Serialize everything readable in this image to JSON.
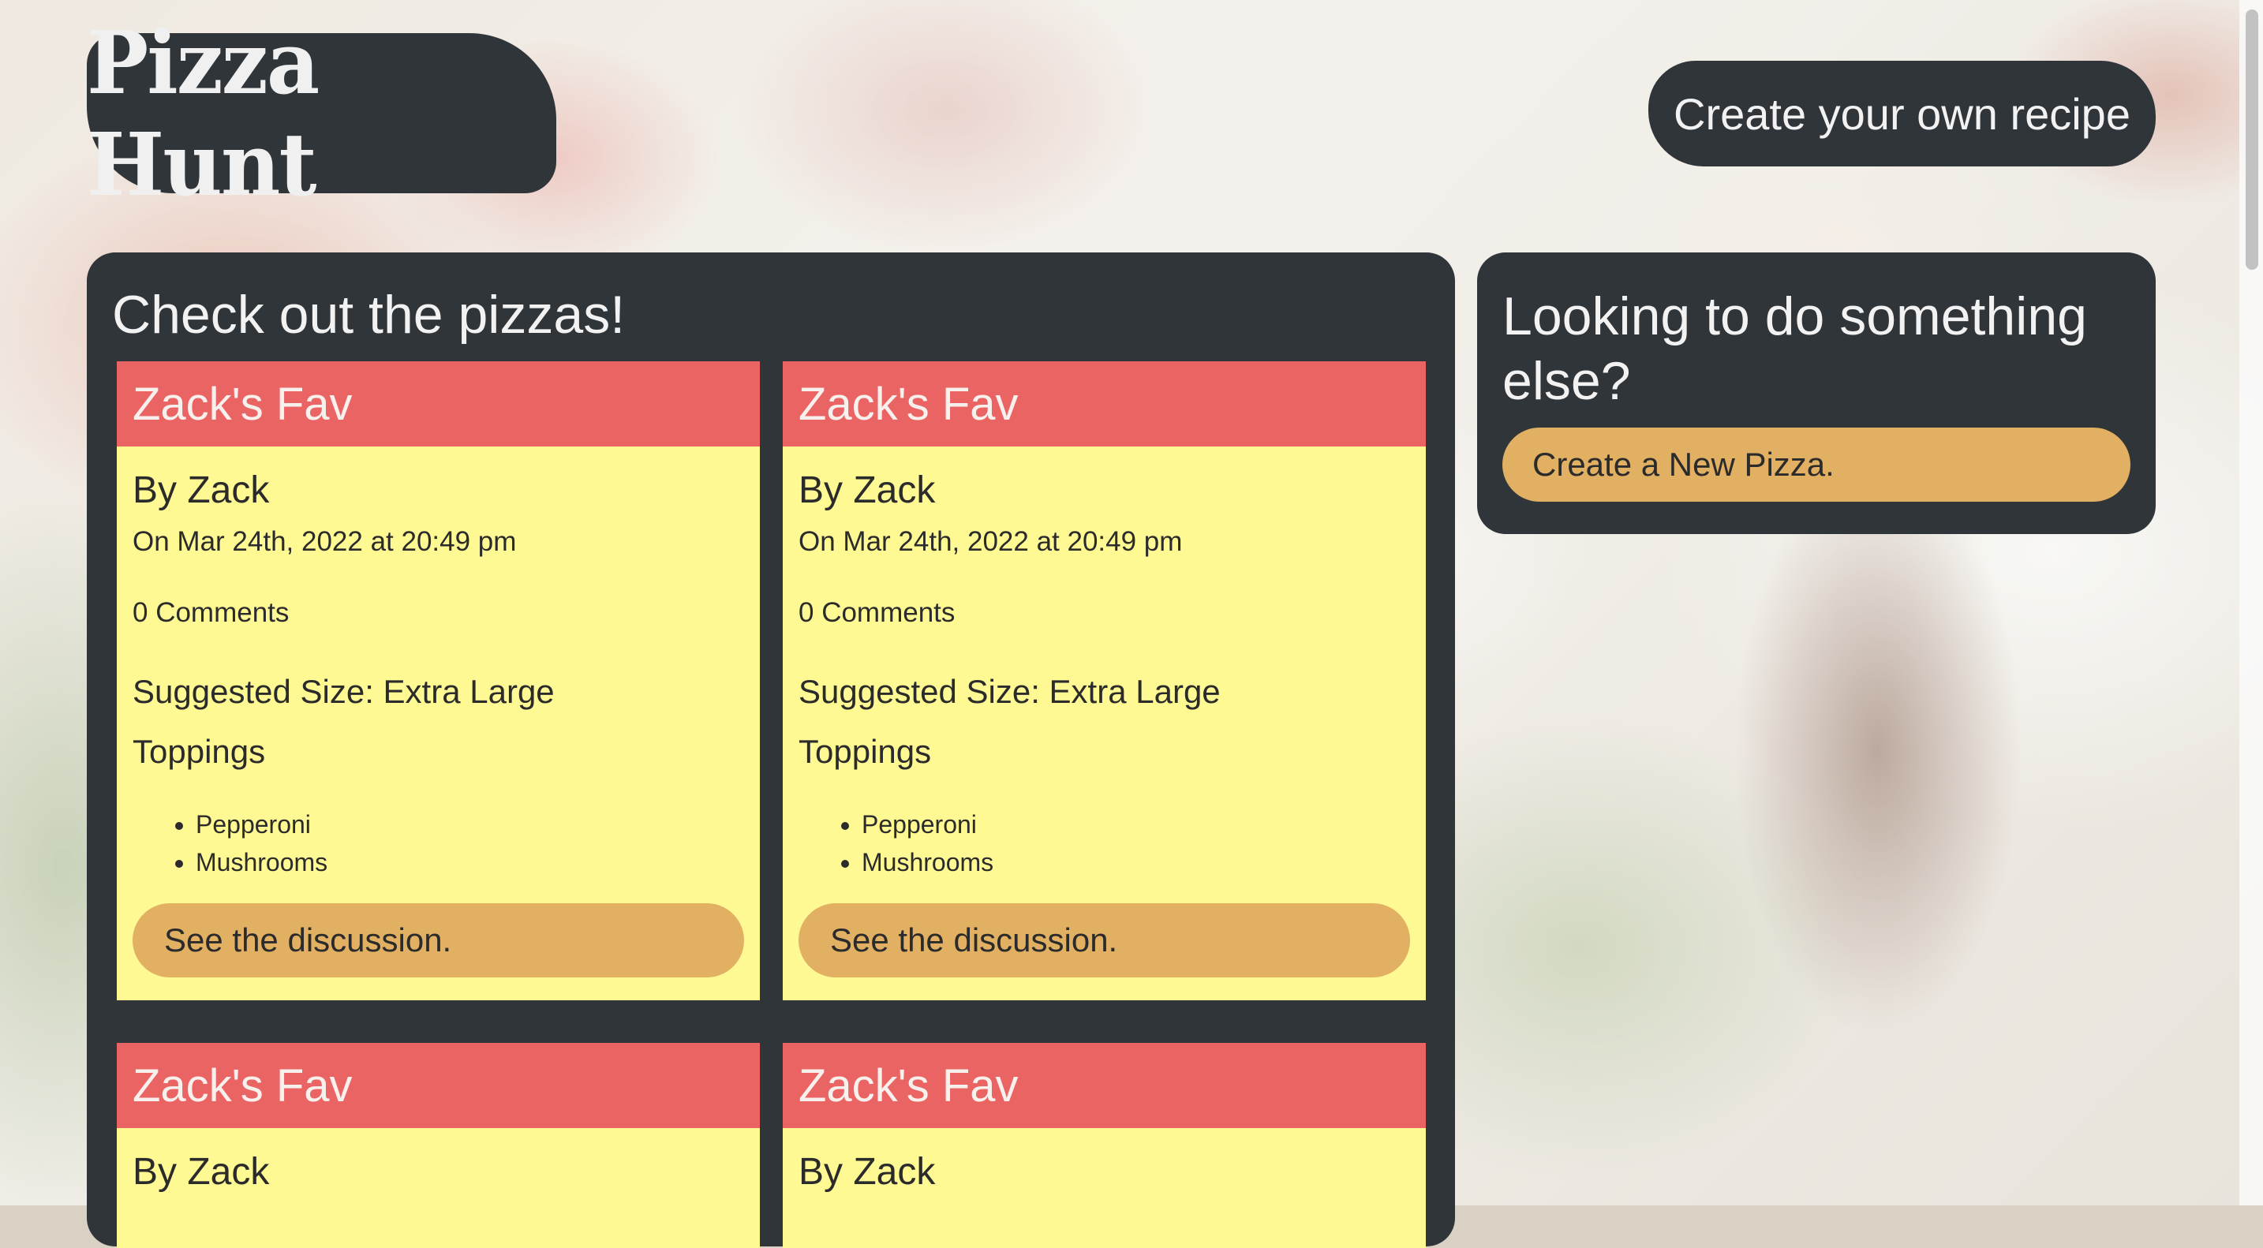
{
  "header": {
    "logo_text": "Pizza Hunt",
    "create_recipe_label": "Create your own recipe"
  },
  "main": {
    "title": "Check out the pizzas!",
    "cards": [
      {
        "name": "Zack's Fav",
        "by": "By Zack",
        "date": "On Mar 24th, 2022 at 20:49 pm",
        "comments": "0 Comments",
        "size": "Suggested Size: Extra Large",
        "toppings_label": "Toppings",
        "toppings": [
          "Pepperoni",
          "Mushrooms"
        ],
        "button": "See the discussion."
      },
      {
        "name": "Zack's Fav",
        "by": "By Zack",
        "date": "On Mar 24th, 2022 at 20:49 pm",
        "comments": "0 Comments",
        "size": "Suggested Size: Extra Large",
        "toppings_label": "Toppings",
        "toppings": [
          "Pepperoni",
          "Mushrooms"
        ],
        "button": "See the discussion."
      },
      {
        "name": "Zack's Fav",
        "by": "By Zack"
      },
      {
        "name": "Zack's Fav",
        "by": "By Zack"
      }
    ]
  },
  "sidebar": {
    "title": "Looking to do something else?",
    "button": "Create a New Pizza."
  },
  "colors": {
    "panel": "#30353a",
    "card_header": "#eb6464",
    "card_body": "#fff993",
    "button": "#e2b062"
  }
}
